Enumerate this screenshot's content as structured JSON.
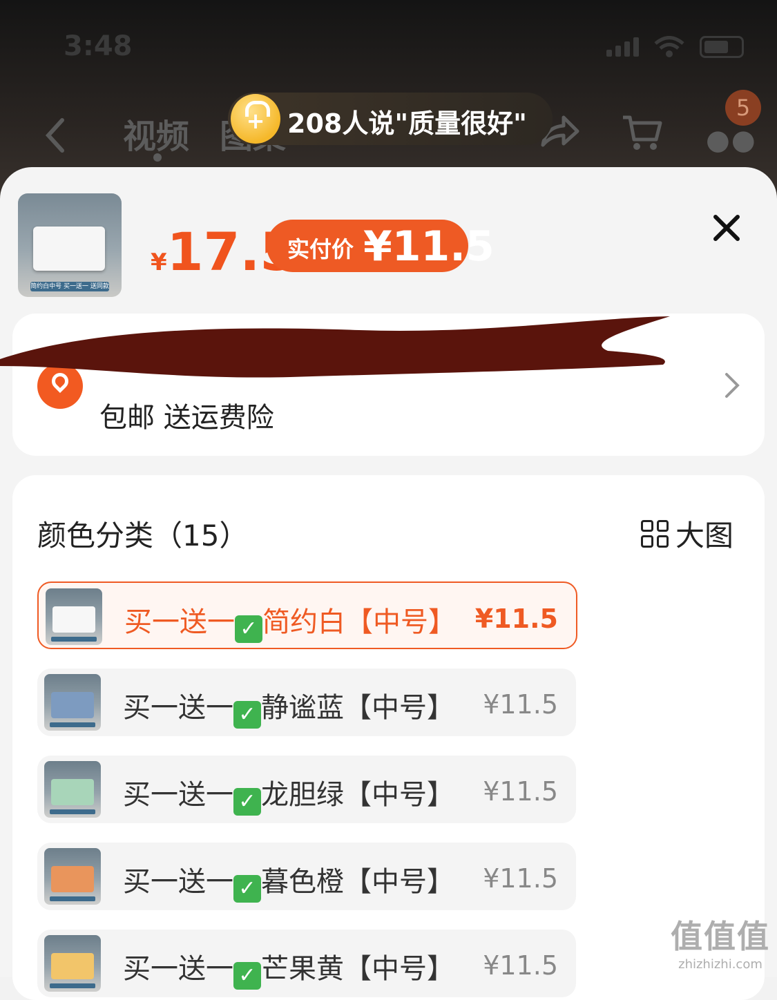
{
  "status": {
    "time": "3:48"
  },
  "nav": {
    "tabs": [
      "视频",
      "图集"
    ],
    "cart_badge": "5"
  },
  "quality_banner": {
    "text": "208人说\"质量很好\""
  },
  "product": {
    "thumb_caption": "简约白中号 买一送一 送同款",
    "price_currency": "¥",
    "price": "17.5",
    "pay_label": "实付价",
    "pay_amount": "¥11.5"
  },
  "address": {
    "shipping": "包邮 送运费险"
  },
  "spec": {
    "title": "颜色分类（15）",
    "big_picture": "大图",
    "options": [
      {
        "prefix": "买一送一",
        "name": "简约白【中号】",
        "price": "¥11.5",
        "box_color": "#f7f7f7"
      },
      {
        "prefix": "买一送一",
        "name": "静谧蓝【中号】",
        "price": "¥11.5",
        "box_color": "#7d9bc0"
      },
      {
        "prefix": "买一送一",
        "name": "龙胆绿【中号】",
        "price": "¥11.5",
        "box_color": "#a8d5b9"
      },
      {
        "prefix": "买一送一",
        "name": "暮色橙【中号】",
        "price": "¥11.5",
        "box_color": "#e9955c"
      },
      {
        "prefix": "买一送一",
        "name": "芒果黄【中号】",
        "price": "¥11.5",
        "box_color": "#f2c56a"
      }
    ]
  },
  "watermark": {
    "line1": "值值值",
    "line2": "zhizhizhi.com"
  }
}
